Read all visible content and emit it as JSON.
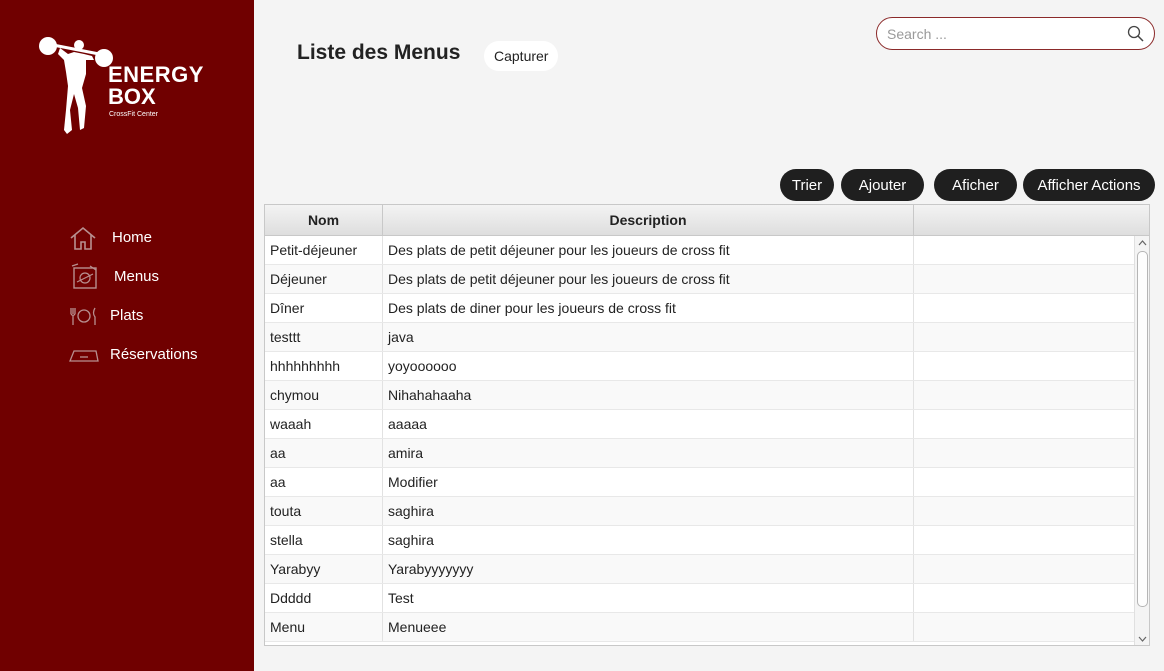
{
  "brand": {
    "line1": "ENERGY",
    "line2": "BOX",
    "tagline": "CrossFit Center"
  },
  "nav": [
    {
      "label": "Home",
      "icon": "home-icon"
    },
    {
      "label": "Menus",
      "icon": "menu-book-icon"
    },
    {
      "label": "Plats",
      "icon": "cutlery-icon"
    },
    {
      "label": "Réservations",
      "icon": "reservation-icon"
    }
  ],
  "page": {
    "title": "Liste des Menus",
    "capture_label": "Capturer"
  },
  "search": {
    "placeholder": "Search ..."
  },
  "actions": {
    "sort": "Trier",
    "add": "Ajouter",
    "show": "Aficher",
    "show_actions": "Afficher Actions"
  },
  "table": {
    "columns": [
      "Nom",
      "Description",
      ""
    ],
    "rows": [
      [
        "Petit-déjeuner",
        "Des plats de petit déjeuner pour les joueurs de cross fit"
      ],
      [
        "Déjeuner",
        "Des plats de petit déjeuner pour les joueurs de cross fit"
      ],
      [
        "Dîner",
        "Des plats de diner pour les joueurs de cross fit"
      ],
      [
        "testtt",
        "java"
      ],
      [
        "hhhhhhhhh",
        "yoyoooooo"
      ],
      [
        "chymou",
        "Nihahahaaha"
      ],
      [
        "waaah",
        "aaaaa"
      ],
      [
        "aa",
        "amira"
      ],
      [
        "aa",
        "Modifier"
      ],
      [
        "touta",
        "saghira"
      ],
      [
        "stella",
        "saghira"
      ],
      [
        "Yarabyy",
        "Yarabyyyyyyy"
      ],
      [
        "Ddddd",
        "Test"
      ],
      [
        "Menu",
        "Menueee"
      ]
    ]
  },
  "colors": {
    "sidebar": "#700000",
    "button": "#1f1f1f",
    "search_border": "#8b2a2a"
  }
}
